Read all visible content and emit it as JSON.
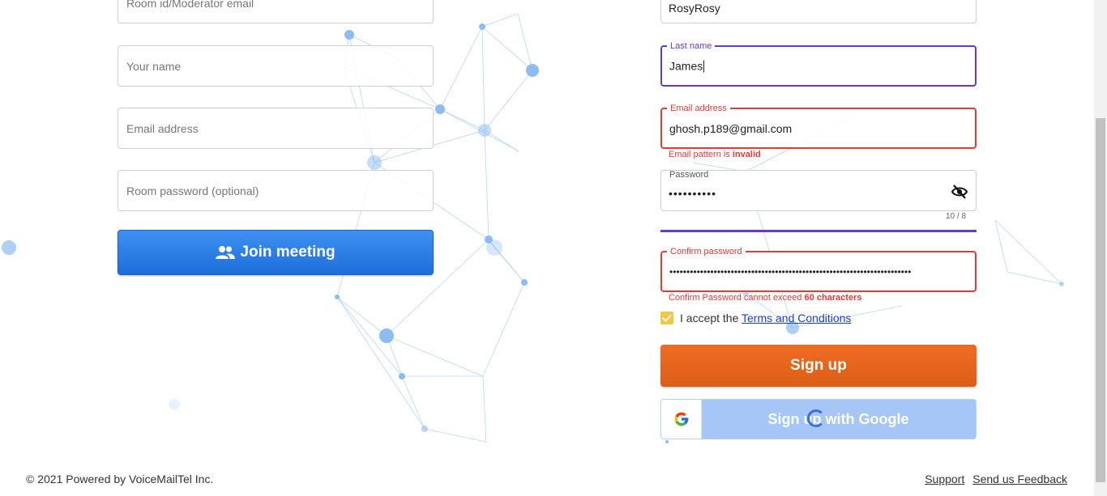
{
  "join": {
    "fields": [
      {
        "placeholder": "Room id/Moderator email"
      },
      {
        "placeholder": "Your name"
      },
      {
        "placeholder": "Email address"
      },
      {
        "placeholder": "Room password (optional)"
      }
    ],
    "join_button": "Join meeting"
  },
  "signup": {
    "first_name": {
      "value": "RosyRosy"
    },
    "last_name": {
      "label": "Last name",
      "value": "James"
    },
    "email": {
      "label": "Email address",
      "value": "ghosh.p189@gmail.com",
      "error_prefix": "Email pattern is ",
      "error_bold": "invalid"
    },
    "password": {
      "label": "Password",
      "value": "••••••••••",
      "counter": "10 / 8"
    },
    "confirm_password": {
      "label": "Confirm password",
      "value": "•••••••••••••••••••••••••••••••••••••••••••••••••••••••••••••••••••••••",
      "error_prefix": "Confirm Password cannot exceed ",
      "error_bold": "60 characters"
    },
    "terms": {
      "prefix": "I accept the ",
      "link": "Terms and Conditions",
      "checked": true
    },
    "signup_button": "Sign up",
    "google_button": "Sign up with Google"
  },
  "footer": {
    "copyright": "© 2021 Powered by VoiceMailTel Inc.",
    "support": "Support",
    "feedback": "Send us Feedback"
  },
  "colors": {
    "primary_blue": "#1e6edb",
    "signup_orange": "#e86520",
    "focus_purple": "#6a3ac0",
    "error_red": "#e23b3b"
  }
}
